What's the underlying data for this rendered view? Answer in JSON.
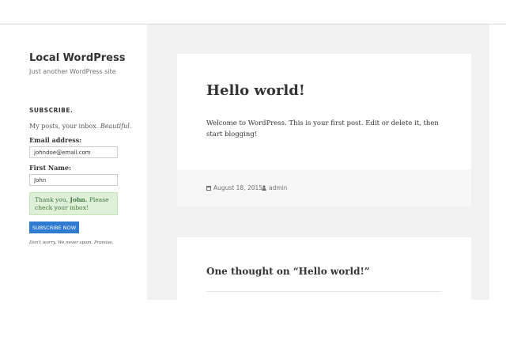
{
  "sidebar": {
    "site_title": "Local WordPress",
    "site_description": "Just another WordPress site",
    "widget": {
      "title": "SUBSCRIBE.",
      "intro_text": "My posts, your inbox. ",
      "intro_emphasis": "Beautiful.",
      "email_label": "Email address:",
      "email_value": "johndoe@email.com",
      "first_name_label": "First Name:",
      "first_name_value": "John",
      "success_prefix": "Thank you, ",
      "success_name": "John.",
      "success_suffix": " Please check your inbox!",
      "subscribe_label": "SUBSCRIBE NOW",
      "fine_print": "Don't worry. We never spam. Promise."
    }
  },
  "post": {
    "title": "Hello world!",
    "content": "Welcome to WordPress. This is your first post. Edit or delete it, then start blogging!",
    "date": "August 18, 2015",
    "author": "admin"
  },
  "comments": {
    "title": "One thought on “Hello world!”"
  },
  "colors": {
    "main_background": "#f1f1f1",
    "button": "#2e7bcf",
    "success_background": "#dff0d8",
    "success_text": "#3c763d"
  }
}
